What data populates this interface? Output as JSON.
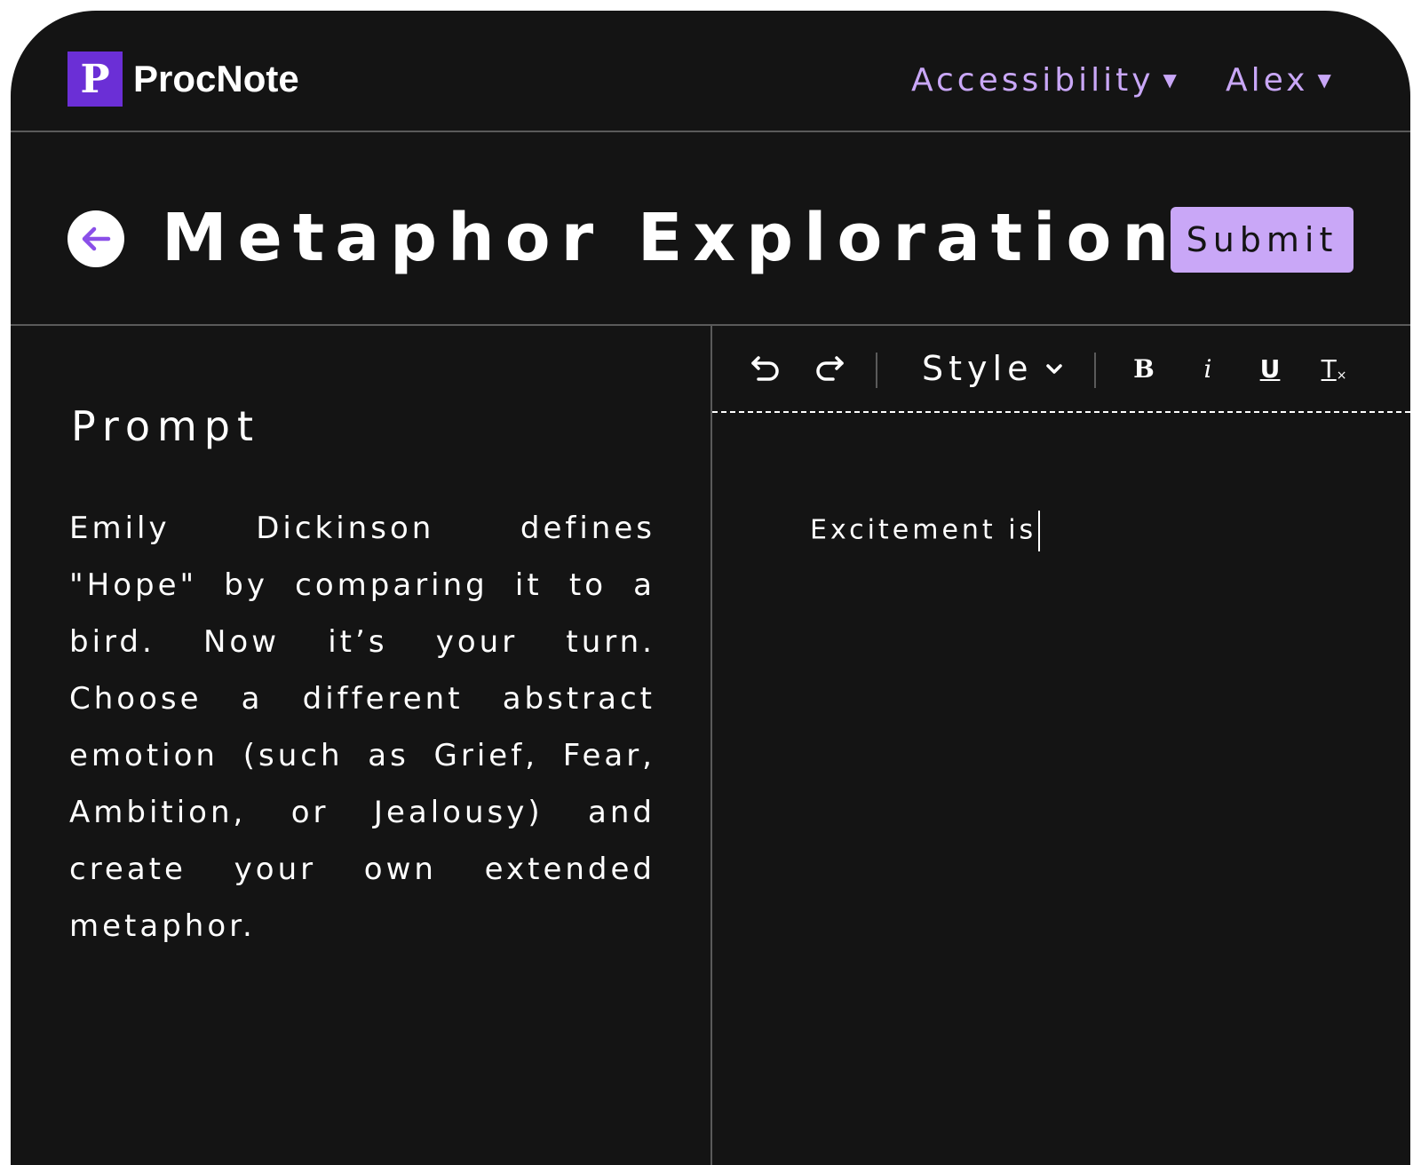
{
  "app": {
    "logo_letter": "P",
    "name": "ProcNote"
  },
  "nav": {
    "accessibility_label": "Accessibility",
    "user_label": "Alex",
    "caret": "▼"
  },
  "page": {
    "title": "Metaphor Exploration",
    "submit_label": "Submit"
  },
  "prompt": {
    "heading": "Prompt",
    "body": "Emily Dickinson defines \"Hope\" by comparing it to a bird. Now it’s your turn. Choose a different abstract emotion (such as Grief, Fear, Ambition, or Jealousy) and create your own extended metaphor."
  },
  "toolbar": {
    "style_label": "Style",
    "bold_label": "B",
    "italic_label": "i",
    "underline_label": "U",
    "clear_format_label": "T"
  },
  "editor": {
    "content": "Excitement is"
  },
  "colors": {
    "background": "#141414",
    "accent": "#c9a7f7",
    "logo": "#6b2fd6",
    "divider": "#5a5a5a"
  }
}
